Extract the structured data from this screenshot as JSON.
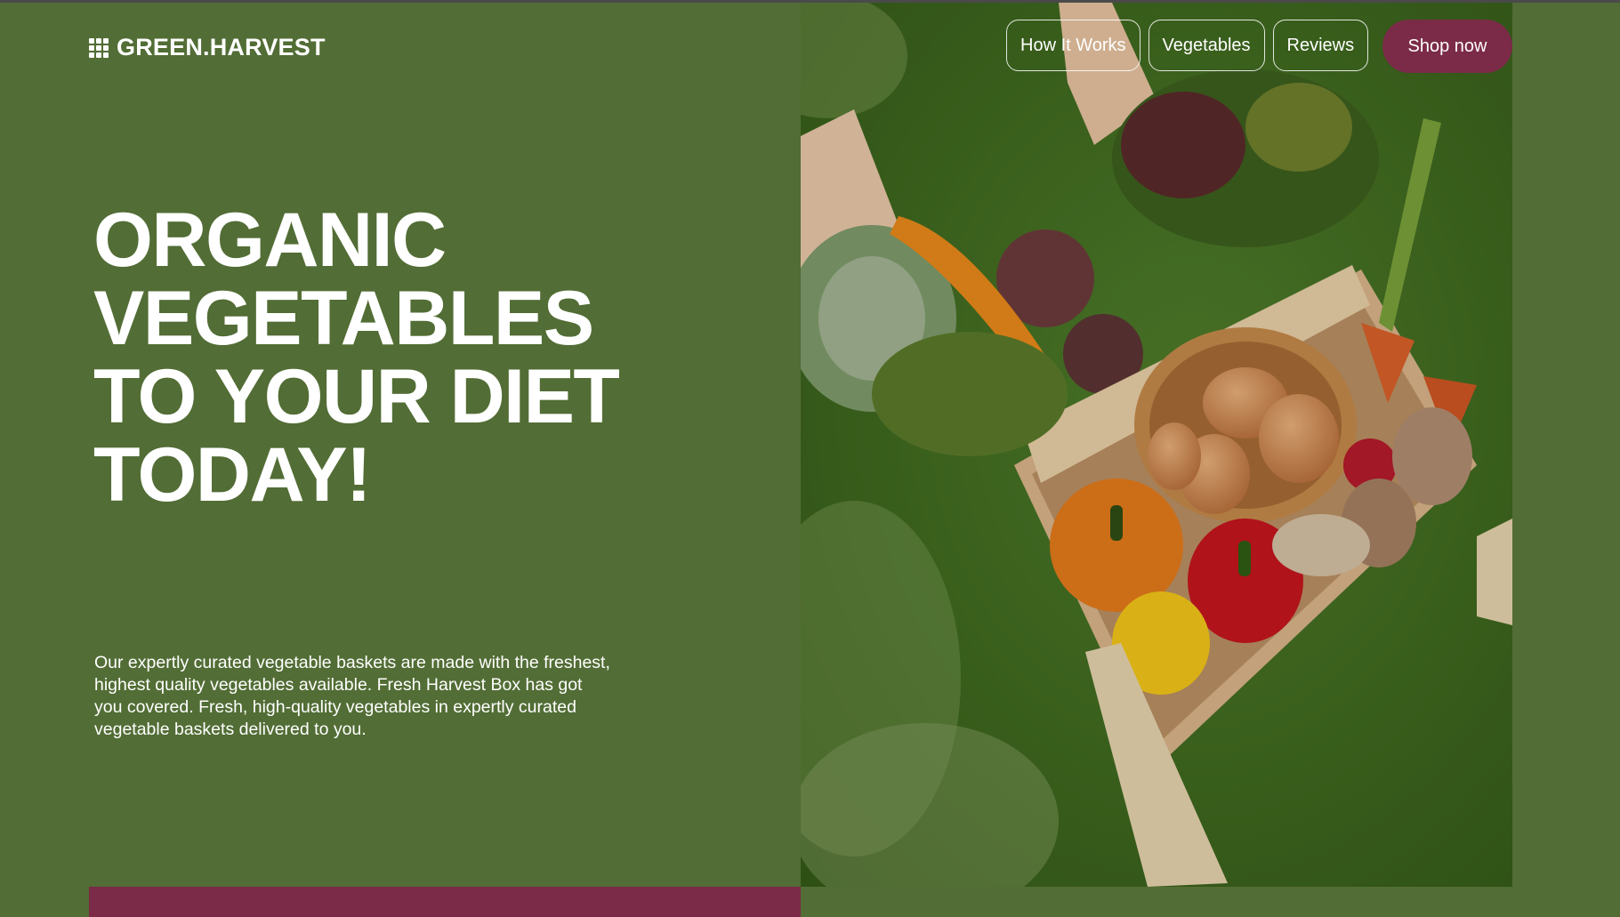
{
  "brand": {
    "name": "GREEN.HARVEST",
    "icon": "grid-icon"
  },
  "nav": {
    "links": [
      "How It Works",
      "Vegetables",
      "Reviews"
    ],
    "cta": "Shop now"
  },
  "hero": {
    "title_lines": [
      "ORGANIC",
      "VEGETABLES",
      "TO YOUR DIET",
      "TODAY!"
    ],
    "description": "Our expertly curated vegetable baskets are made with the freshest, highest quality vegetables available. Fresh Harvest Box has got you covered. Fresh, high-quality vegetables in expertly curated vegetable baskets delivered to you.",
    "image": "basket-of-vegetables-photo"
  },
  "colors": {
    "background": "#526d35",
    "accent": "#7b2b47",
    "text": "#ffffff"
  }
}
